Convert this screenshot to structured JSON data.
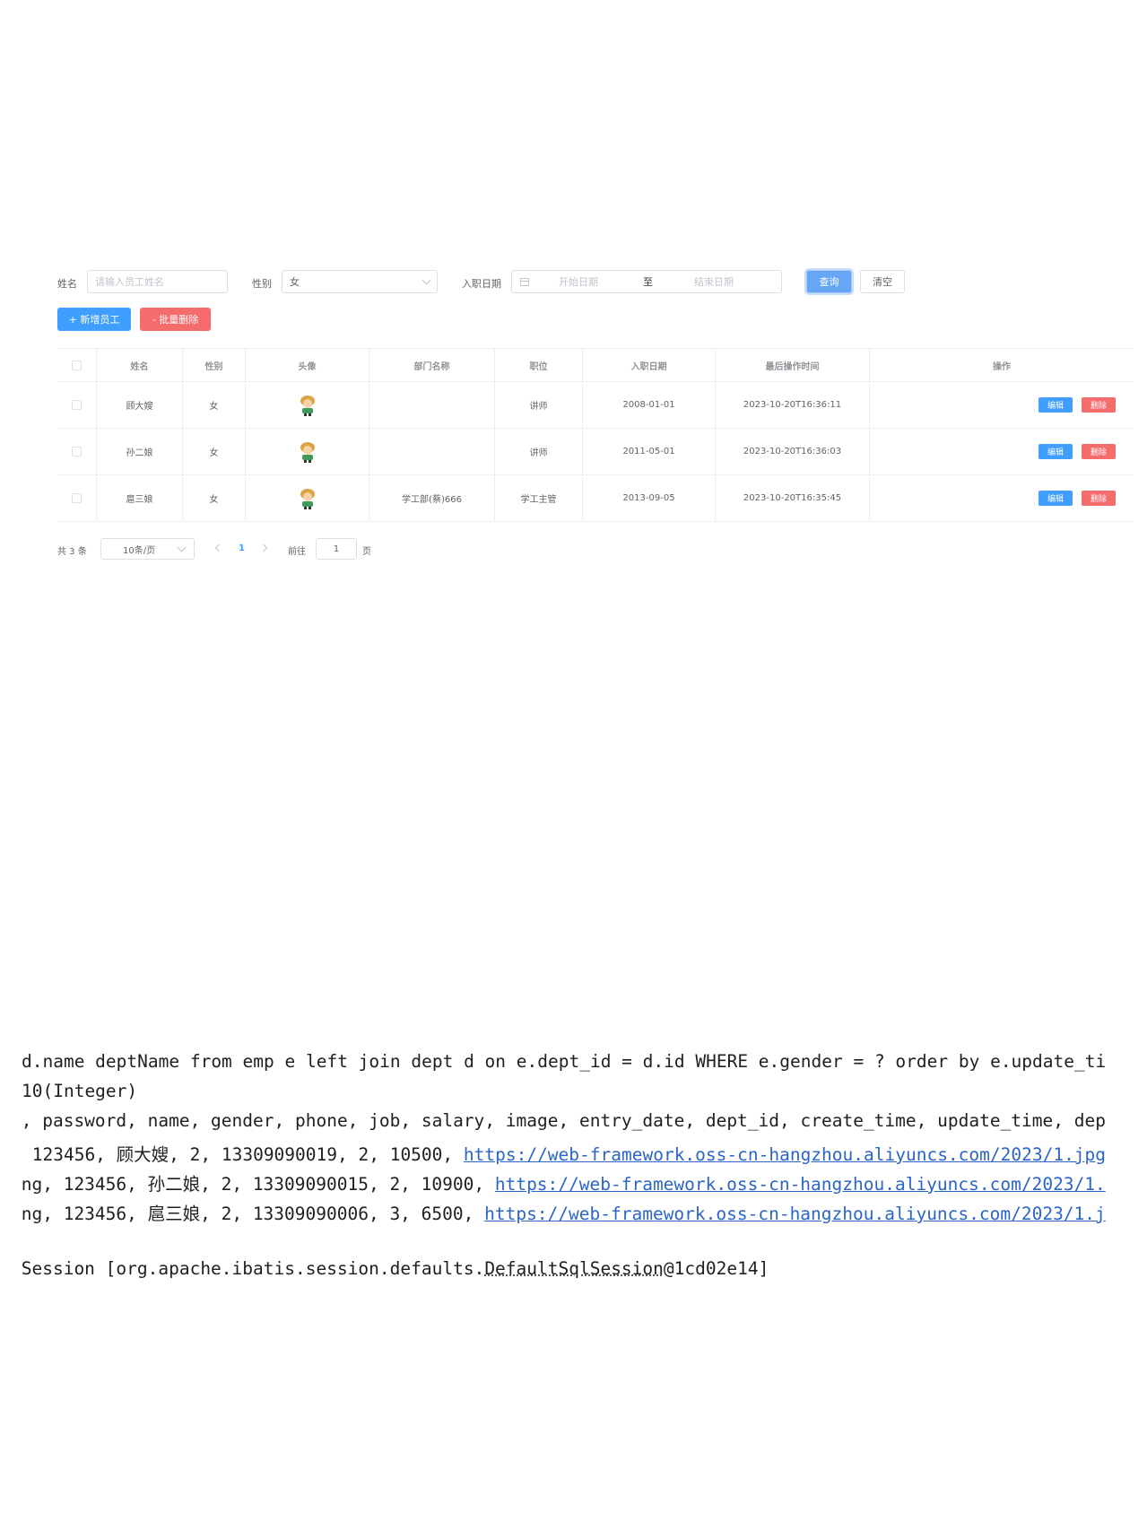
{
  "search": {
    "name_label": "姓名",
    "name_placeholder": "请输入员工姓名",
    "gender_label": "性别",
    "gender_value": "女",
    "entry_label": "入职日期",
    "start_placeholder": "开始日期",
    "range_sep": "至",
    "end_placeholder": "结束日期",
    "query_label": "查询",
    "clear_label": "清空"
  },
  "actions": {
    "add_label": "+ 新增员工",
    "batch_delete_label": "- 批量删除"
  },
  "table": {
    "headers": [
      "姓名",
      "性别",
      "头像",
      "部门名称",
      "职位",
      "入职日期",
      "最后操作时间",
      "操作"
    ],
    "rows": [
      {
        "name": "顾大嫂",
        "gender": "女",
        "dept": "",
        "job": "讲师",
        "entry": "2008-01-01",
        "updated": "2023-10-20T16:36:11"
      },
      {
        "name": "孙二娘",
        "gender": "女",
        "dept": "",
        "job": "讲师",
        "entry": "2011-05-01",
        "updated": "2023-10-20T16:36:03"
      },
      {
        "name": "扈三娘",
        "gender": "女",
        "dept": "学工部(蔡)666",
        "job": "学工主管",
        "entry": "2013-09-05",
        "updated": "2023-10-20T16:35:45"
      }
    ],
    "edit_label": "编辑",
    "delete_label": "删除"
  },
  "pagination": {
    "total": "共 3 条",
    "page_size": "10条/页",
    "current": "1",
    "goto_label": "前往",
    "goto_value": "1",
    "page_unit": "页"
  },
  "console": {
    "line1": "d.name deptName from emp e left join dept d on e.dept_id = d.id WHERE e.gender = ? order by e.update_ti",
    "line2": "10(Integer)",
    "line3": ":, password, name, gender, phone, job, salary, image, entry_date, dept_id, create_time, update_time, dep",
    "line4_prefix": " 123456, 顾大嫂, 2, 13309090019, 2, 10500, ",
    "line4_link": "https://web-framework.oss-cn-hangzhou.aliyuncs.com/2023/1.jpg",
    "line5_prefix": "ing, 123456, 孙二娘, 2, 13309090015, 2, 10900, ",
    "line5_link": "https://web-framework.oss-cn-hangzhou.aliyuncs.com/2023/1.",
    "line6_prefix": "ing, 123456, 扈三娘, 2, 13309090006, 3, 6500, ",
    "line6_link": "https://web-framework.oss-cn-hangzhou.aliyuncs.com/2023/1.j",
    "line7_prefix": "lSession [org.apache.ibatis.session.defaults.",
    "line7_dotted": "DefaultSqlSession",
    "line7_suffix": "@1cd02e14]"
  }
}
